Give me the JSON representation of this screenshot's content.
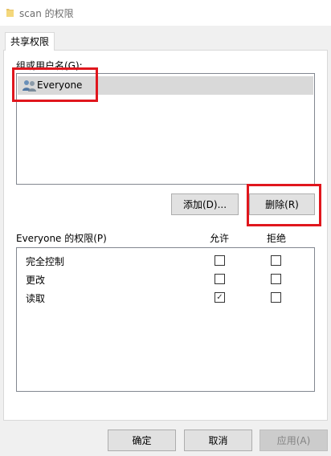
{
  "window": {
    "title": "scan 的权限"
  },
  "tabs": [
    {
      "label": "共享权限"
    }
  ],
  "groups": {
    "label": "组或用户名(G):",
    "items": [
      {
        "name": "Everyone",
        "icon": "users-icon",
        "selected": true
      }
    ]
  },
  "buttons": {
    "add": "添加(D)...",
    "remove": "删除(R)",
    "ok": "确定",
    "cancel": "取消",
    "apply": "应用(A)"
  },
  "permissions": {
    "label": "Everyone 的权限(P)",
    "allow_header": "允许",
    "deny_header": "拒绝",
    "items": [
      {
        "name": "完全控制",
        "allow": false,
        "deny": false
      },
      {
        "name": "更改",
        "allow": false,
        "deny": false
      },
      {
        "name": "读取",
        "allow": true,
        "deny": false
      }
    ]
  },
  "colors": {
    "highlight": "#e0161d",
    "selection": "#d9d9d9"
  }
}
